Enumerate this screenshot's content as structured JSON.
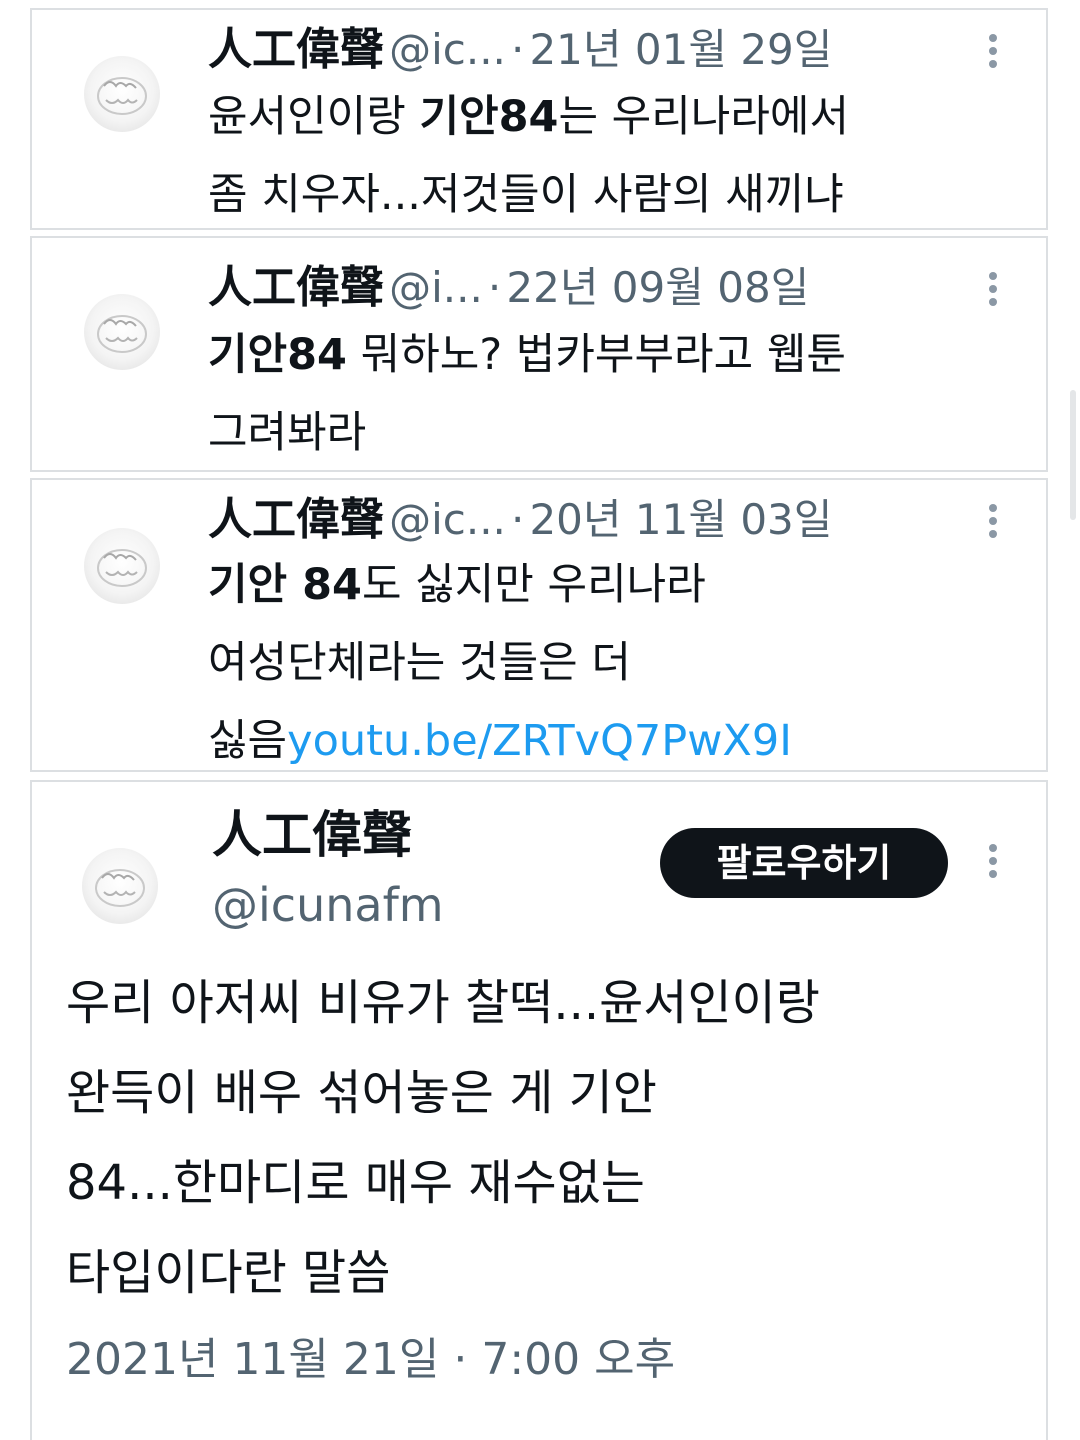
{
  "tweets": [
    {
      "name": "人工偉聲",
      "handle": "@ic...",
      "separator": "·",
      "date": "21년 01월 29일",
      "line1_a": "윤서인이랑 ",
      "line1_bold": "기안84",
      "line1_b": "는 우리나라에서",
      "line2": "좀 치우자...저것들이 사람의 새끼냐"
    },
    {
      "name": "人工偉聲",
      "handle": "@i...",
      "separator": "·",
      "date": "22년 09월 08일",
      "line1_bold": "기안84",
      "line1_b": " 뭐하노? 법카부부라고 웹툰",
      "line2": "그려봐라"
    },
    {
      "name": "人工偉聲",
      "handle": "@ic...",
      "separator": "·",
      "date": "20년 11월 03일",
      "line1_bold": "기안 84",
      "line1_b": "도 싫지만 우리나라",
      "line2": "여성단체라는 것들은 더",
      "line3_a": "싫음",
      "line3_link": "youtu.be/ZRTvQ7PwX9I"
    }
  ],
  "main": {
    "name": "人工偉聲",
    "handle": "@icunafm",
    "follow_label": "팔로우하기",
    "lines": [
      "우리 아저씨 비유가 찰떡...윤서인이랑",
      "완득이 배우 섞어놓은 게 기안",
      "84...한마디로 매우 재수없는",
      "타입이다란 말씀"
    ],
    "timestamp": "2021년 11월 21일 · 7:00 오후"
  },
  "icons": {
    "avatar": "avatar-ring-image",
    "more": "more-vertical-icon"
  },
  "colors": {
    "text": "#0f1419",
    "secondary": "#536471",
    "link": "#1d9bf0",
    "border": "#dcdfe2",
    "button": "#0f1419"
  }
}
